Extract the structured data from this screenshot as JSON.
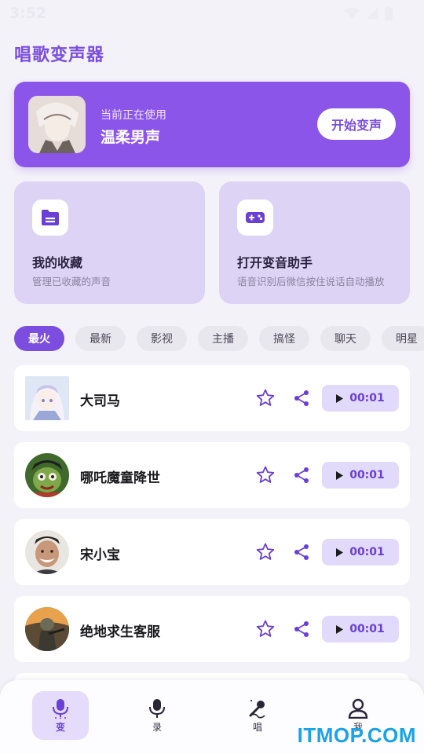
{
  "status_bar": {
    "time": "3:52"
  },
  "app_title": "唱歌变声器",
  "hero": {
    "subtitle": "当前正在使用",
    "voice_name": "温柔男声",
    "button_label": "开始变声"
  },
  "features": [
    {
      "title": "我的收藏",
      "desc": "管理已收藏的声音",
      "icon": "folder-icon"
    },
    {
      "title": "打开变音助手",
      "desc": "语音识别后微信按住说话自动播放",
      "icon": "gamepad-icon"
    }
  ],
  "chips": [
    "最火",
    "最新",
    "影视",
    "主播",
    "搞怪",
    "聊天",
    "明星"
  ],
  "active_chip": "最火",
  "list": [
    {
      "name": "大司马",
      "duration": "00:01"
    },
    {
      "name": "哪吒魔童降世",
      "duration": "00:01"
    },
    {
      "name": "宋小宝",
      "duration": "00:01"
    },
    {
      "name": "绝地求生客服",
      "duration": "00:01"
    }
  ],
  "nav": [
    {
      "label": "变",
      "icon": "mic-icon",
      "active": true
    },
    {
      "label": "录",
      "icon": "record-icon",
      "active": false
    },
    {
      "label": "唱",
      "icon": "sing-icon",
      "active": false
    },
    {
      "label": "我",
      "icon": "profile-icon",
      "active": false
    }
  ],
  "watermark": "ITMOP.COM",
  "colors": {
    "accent": "#7b4ee0",
    "hero_bg": "#8c55ea",
    "feature_bg": "#ddd3f5",
    "page_bg": "#f4f2f9"
  }
}
